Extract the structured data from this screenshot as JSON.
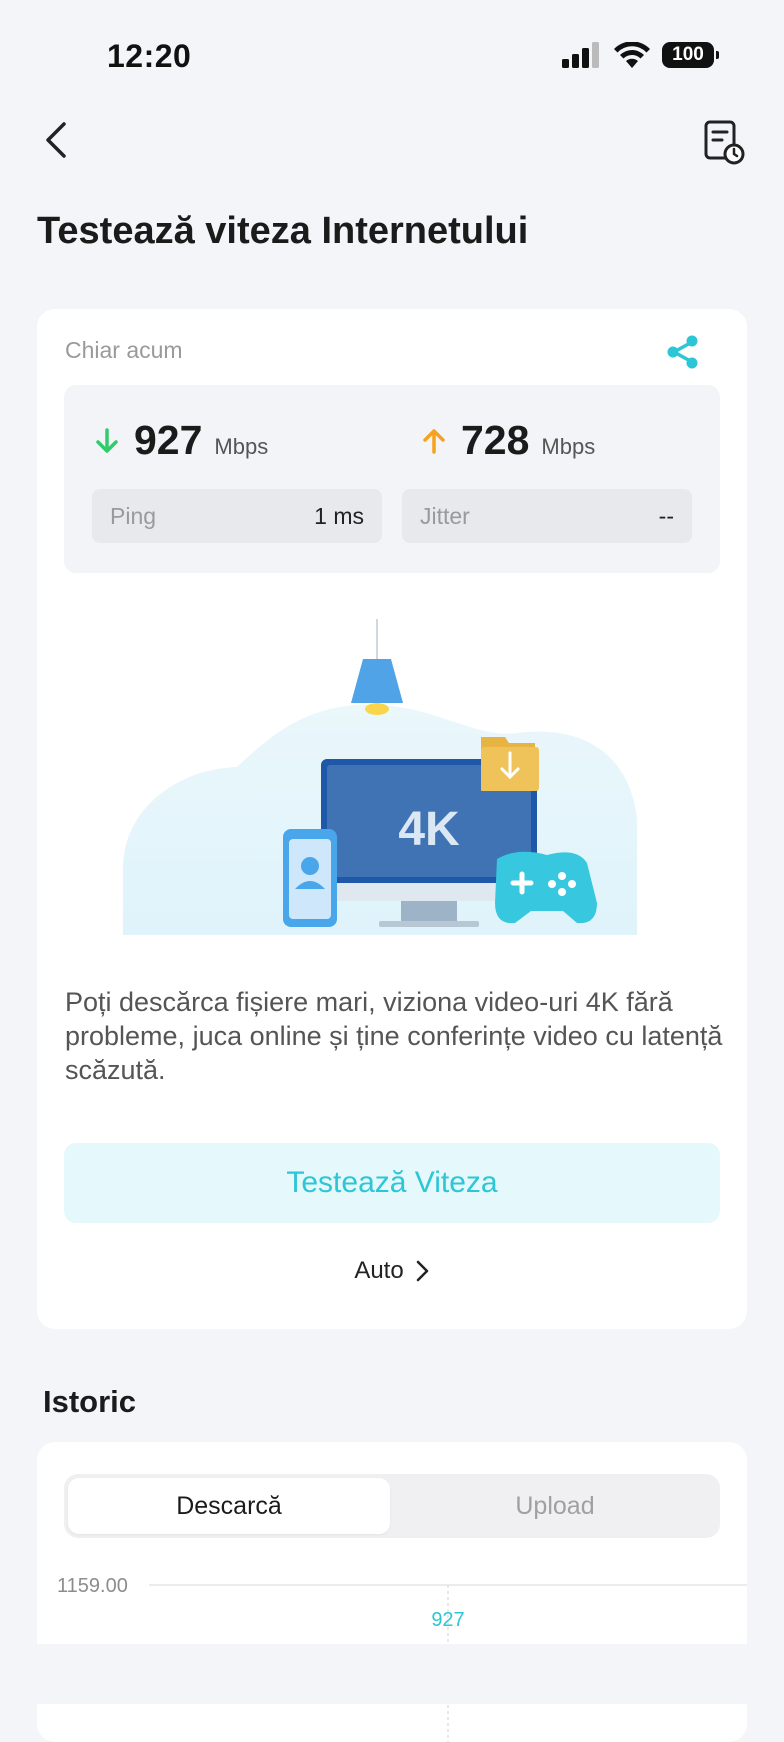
{
  "status_bar": {
    "time": "12:20",
    "battery": "100"
  },
  "header": {
    "back_icon": "chevron-left-icon",
    "history_icon": "report-clock-icon",
    "title": "Testează viteza Internetului"
  },
  "result_card": {
    "label": "Chiar acum",
    "share_icon": "share-icon",
    "download": {
      "value": "927",
      "unit": "Mbps",
      "color": "#2fcc6b"
    },
    "upload": {
      "value": "728",
      "unit": "Mbps",
      "color": "#f6a21e"
    },
    "ping": {
      "label": "Ping",
      "value": "1 ms"
    },
    "jitter": {
      "label": "Jitter",
      "value": "--"
    },
    "illustration_text": "4K",
    "description": "Poți descărca fișiere mari, viziona video-uri 4K fără probleme, juca online și ține conferințe video cu latență scăzută.",
    "test_button": "Testează Viteza",
    "mode": "Auto"
  },
  "history": {
    "title": "Istoric",
    "tabs": [
      {
        "label": "Descarcă",
        "active": true
      },
      {
        "label": "Upload",
        "active": false
      }
    ]
  },
  "chart_data": {
    "type": "line",
    "title": "",
    "xlabel": "",
    "ylabel": "",
    "y_tick_labels": [
      "1159.00"
    ],
    "series": [
      {
        "values": [
          927
        ]
      }
    ],
    "data_labels": [
      "927"
    ],
    "accent_color": "#2cc6d6"
  }
}
